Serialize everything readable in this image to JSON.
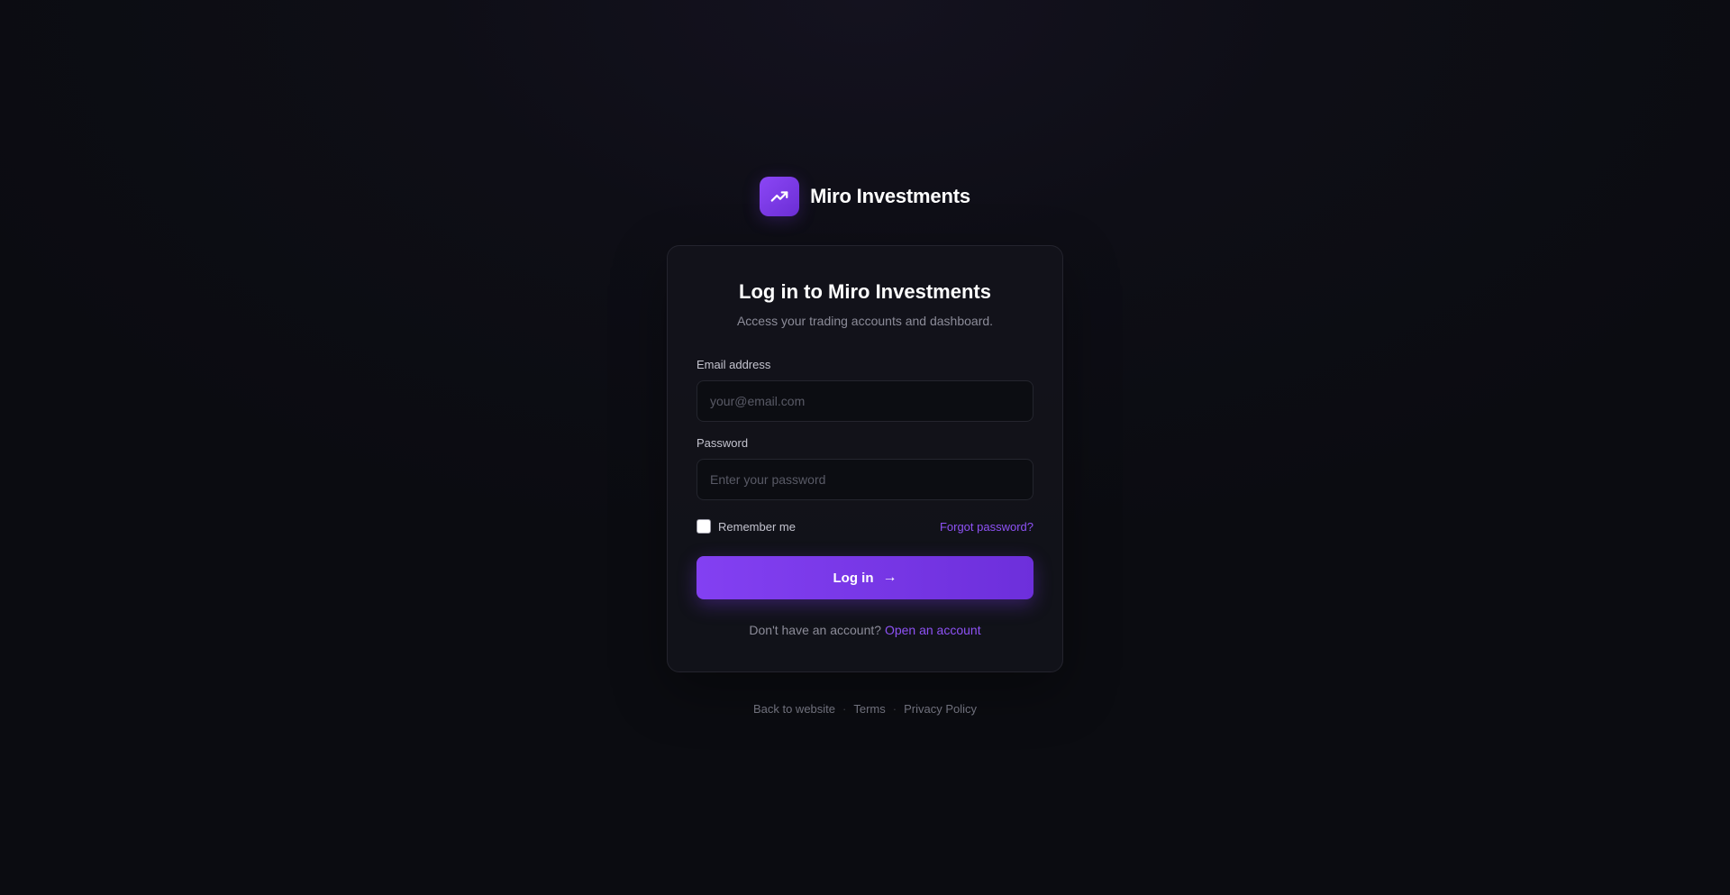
{
  "brand": {
    "name": "Miro Investments",
    "logo_icon": "trending-up-icon",
    "accent_color": "#7c3aed"
  },
  "card": {
    "title": "Log in to Miro Investments",
    "subtitle": "Access your trading accounts and dashboard."
  },
  "form": {
    "email": {
      "label": "Email address",
      "placeholder": "your@email.com",
      "value": ""
    },
    "password": {
      "label": "Password",
      "placeholder": "Enter your password",
      "value": ""
    },
    "remember": {
      "label": "Remember me",
      "checked": false
    },
    "forgot_label": "Forgot password?",
    "submit": {
      "label": "Log in",
      "icon": "arrow-right-icon",
      "glyph": "→"
    }
  },
  "signup": {
    "prompt": "Don't have an account?",
    "link_label": "Open an account"
  },
  "footer": {
    "links": [
      "Back to website",
      "Terms",
      "Privacy Policy"
    ],
    "separator": "·"
  }
}
